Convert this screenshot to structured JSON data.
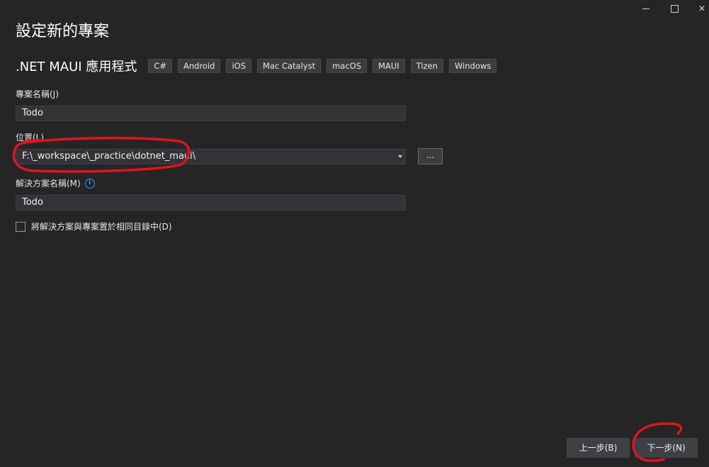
{
  "window": {
    "controls": {
      "minimize": "minimize",
      "maximize": "maximize",
      "close": "✕"
    }
  },
  "title": "設定新的專案",
  "template": {
    "name": ".NET MAUI 應用程式",
    "tags": [
      "C#",
      "Android",
      "iOS",
      "Mac Catalyst",
      "macOS",
      "MAUI",
      "Tizen",
      "Windows"
    ]
  },
  "form": {
    "project_name": {
      "label": "專案名稱(J)",
      "value": "Todo"
    },
    "location": {
      "label": "位置(L)",
      "value": "F:\\_workspace\\_practice\\dotnet_maui\\",
      "browse_label": "..."
    },
    "solution_name": {
      "label": "解決方案名稱(M)",
      "info_icon": "i",
      "value": "Todo"
    },
    "same_directory": {
      "label": "將解決方案與專案置於相同目錄中(D)",
      "checked": false
    }
  },
  "footer": {
    "back_label": "上一步(B)",
    "next_label": "下一步(N)"
  },
  "annotation_color": "#e0141e"
}
